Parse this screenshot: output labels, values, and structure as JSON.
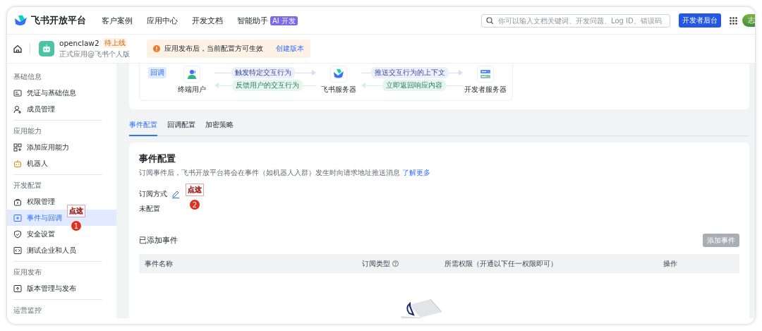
{
  "topnav": {
    "brand": "飞书开放平台",
    "links": [
      {
        "label": "客户案例"
      },
      {
        "label": "应用中心"
      },
      {
        "label": "开发文档"
      },
      {
        "label": "智能助手",
        "badge": "AI 开发"
      }
    ],
    "search": {
      "placeholder": "你可以输入文档关键词、开发问题、Log ID、错误码"
    },
    "console_button": "开发者后台",
    "avatar": "志"
  },
  "appbar": {
    "app_name": "openclaw2",
    "status": "待上线",
    "subtitle": "正式应用@飞书个人版",
    "notice": {
      "text": "应用发布后，当前配置方可生效",
      "link": "创建版本"
    }
  },
  "sidebar": {
    "groups": [
      {
        "heading": "基础信息",
        "items": [
          {
            "label": "凭证与基础信息",
            "selected": false
          },
          {
            "label": "成员管理",
            "selected": false
          }
        ]
      },
      {
        "heading": "应用能力",
        "items": [
          {
            "label": "添加应用能力",
            "selected": false
          },
          {
            "label": "机器人",
            "selected": false
          }
        ]
      },
      {
        "heading": "开发配置",
        "items": [
          {
            "label": "权限管理",
            "selected": false
          },
          {
            "label": "事件与回调",
            "selected": true
          },
          {
            "label": "安全设置",
            "selected": false
          },
          {
            "label": "测试企业和人员",
            "selected": false
          }
        ]
      },
      {
        "heading": "应用发布",
        "items": [
          {
            "label": "版本管理与发布",
            "selected": false
          }
        ]
      },
      {
        "heading": "运营监控"
      }
    ]
  },
  "diagram": {
    "tag": "回调",
    "nodes": [
      {
        "label": "终端用户"
      },
      {
        "label": "飞书服务器"
      },
      {
        "label": "开发者服务器"
      }
    ],
    "links": [
      {
        "forward": "触发特定交互行为",
        "back": "反馈用户的交互行为"
      },
      {
        "forward": "推送交互行为的上下文",
        "back": "立即返回响应内容"
      }
    ]
  },
  "tabs": [
    {
      "label": "事件配置",
      "selected": true
    },
    {
      "label": "回调配置",
      "selected": false
    },
    {
      "label": "加密策略",
      "selected": false
    }
  ],
  "event_config": {
    "title": "事件配置",
    "description": "订阅事件后，飞书开放平台将会在事件（如机器人入群）发生时向请求地址推送消息",
    "learn_more": "了解更多",
    "subscription_label": "订阅方式",
    "subscription_value": "未配置",
    "added_title": "已添加事件",
    "add_button": {
      "label": "添加事件",
      "disabled": true
    },
    "table": {
      "columns": [
        {
          "label": "事件名称",
          "help": false
        },
        {
          "label": "订阅类型",
          "help": true
        },
        {
          "label": "所需权限（开通以下任一权限即可）",
          "help": false
        },
        {
          "label": "操作",
          "help": false
        }
      ]
    }
  },
  "annotations": [
    {
      "label": "点这",
      "number": "1"
    },
    {
      "label": "点这",
      "number": "2"
    }
  ]
}
